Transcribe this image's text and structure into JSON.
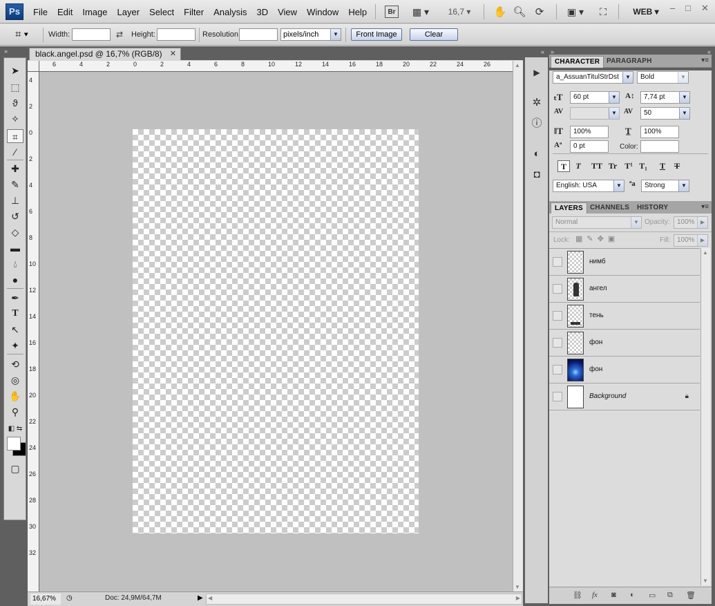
{
  "app": {
    "logo": "Ps"
  },
  "menu": [
    "File",
    "Edit",
    "Image",
    "Layer",
    "Select",
    "Filter",
    "Analysis",
    "3D",
    "View",
    "Window",
    "Help"
  ],
  "appbar": {
    "bridge_label": "Br",
    "zoom": "16,7",
    "workspace": "WEB",
    "minimize": "–",
    "restore": "□",
    "close": "✕"
  },
  "options": {
    "width_label": "Width:",
    "height_label": "Height:",
    "resolution_label": "Resolution:",
    "width_value": "",
    "height_value": "",
    "resolution_value": "",
    "resolution_unit": "pixels/inch",
    "front_image": "Front Image",
    "clear": "Clear"
  },
  "document": {
    "tab_title": "black.angel.psd @ 16,7% (RGB/8)",
    "tab_close": "✕",
    "zoom_field": "16,67%",
    "info": "Doc: 24,9M/64,7M",
    "ruler_h": [
      "6",
      "4",
      "2",
      "0",
      "2",
      "4",
      "6",
      "8",
      "10",
      "12",
      "14",
      "16",
      "18",
      "20",
      "22",
      "24",
      "26"
    ],
    "ruler_v": [
      "4",
      "2",
      "0",
      "2",
      "4",
      "6",
      "8",
      "10",
      "12",
      "14",
      "16",
      "18",
      "20",
      "22",
      "24",
      "26",
      "28",
      "30",
      "32"
    ]
  },
  "character_panel": {
    "tabs": [
      "CHARACTER",
      "PARAGRAPH"
    ],
    "font_family": "a_AssuanTitulStrDst",
    "font_style": "Bold",
    "font_size": "60 pt",
    "leading": "7,74 pt",
    "kerning": "",
    "tracking": "50",
    "vertical_scale": "100%",
    "horizontal_scale": "100%",
    "baseline_shift": "0 pt",
    "color_label": "Color:",
    "language": "English: USA",
    "antialias": "Strong",
    "style_buttons": [
      "T",
      "T",
      "TT",
      "Tr",
      "T¹",
      "T₁",
      "T",
      "T"
    ]
  },
  "layers_panel": {
    "tabs": [
      "LAYERS",
      "CHANNELS",
      "HISTORY"
    ],
    "blend_mode": "Normal",
    "opacity_label": "Opacity:",
    "opacity": "100%",
    "lock_label": "Lock:",
    "fill_label": "Fill:",
    "fill": "100%",
    "layers": [
      {
        "name": "нимб",
        "thumb": "transparent"
      },
      {
        "name": "ангел",
        "thumb": "figure"
      },
      {
        "name": "тень",
        "thumb": "shadow"
      },
      {
        "name": "фон",
        "thumb": "transparent"
      },
      {
        "name": "фон",
        "thumb": "blue"
      },
      {
        "name": "Background",
        "thumb": "white",
        "locked": true
      }
    ]
  },
  "colors": {
    "accent": "#2a5fa8",
    "panel_dark": "#5f5f5f",
    "canvas_bg": "#c0c0c0"
  }
}
